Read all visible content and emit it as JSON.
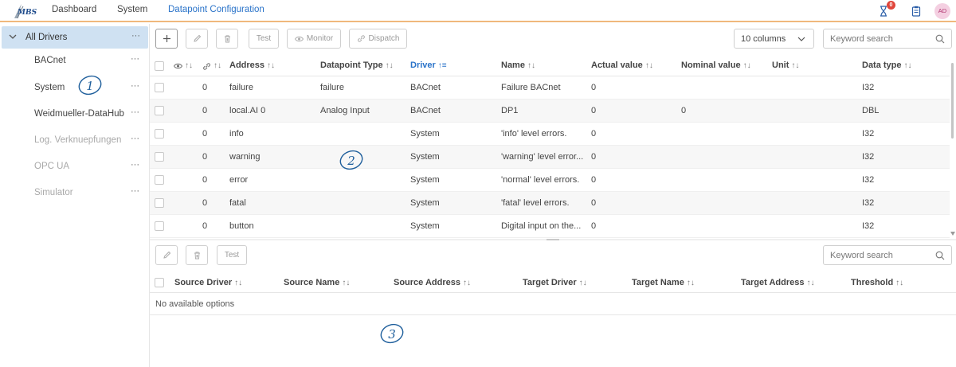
{
  "app": {
    "logo_text": "MBS"
  },
  "nav": {
    "items": [
      {
        "label": "Dashboard",
        "active": false
      },
      {
        "label": "System",
        "active": false
      },
      {
        "label": "Datapoint Configuration",
        "active": true
      }
    ]
  },
  "top_icons": {
    "notification_count": "0",
    "avatar_initials": "AD"
  },
  "sidebar": {
    "root": {
      "label": "All Drivers",
      "more": "···"
    },
    "items": [
      {
        "label": "BACnet",
        "enabled": true,
        "more": "···"
      },
      {
        "label": "System",
        "enabled": true,
        "more": "···"
      },
      {
        "label": "Weidmueller-DataHub",
        "enabled": true,
        "more": "···"
      },
      {
        "label": "Log. Verknuepfungen",
        "enabled": false,
        "more": "···"
      },
      {
        "label": "OPC UA",
        "enabled": false,
        "more": "···"
      },
      {
        "label": "Simulator",
        "enabled": false,
        "more": "···"
      }
    ]
  },
  "toolbar": {
    "test_label": "Test",
    "monitor_label": "Monitor",
    "dispatch_label": "Dispatch",
    "columns_select": "10 columns",
    "search_placeholder": "Keyword search"
  },
  "table": {
    "columns": {
      "address": "Address",
      "datapoint_type": "Datapoint Type",
      "driver": "Driver",
      "name": "Name",
      "actual_value": "Actual value",
      "nominal_value": "Nominal value",
      "unit": "Unit",
      "data_type": "Data type"
    },
    "sort_icon": "↑↓",
    "sorted_icon": "↑≡",
    "rows": [
      {
        "v1": "0",
        "address": "failure",
        "datapoint_type": "failure",
        "driver": "BACnet",
        "name": "Failure BACnet",
        "actual": "0",
        "nominal": "",
        "unit": "",
        "data_type": "I32"
      },
      {
        "v1": "0",
        "address": "local.AI 0",
        "datapoint_type": "Analog Input",
        "driver": "BACnet",
        "name": "DP1",
        "actual": "0",
        "nominal": "0",
        "unit": "",
        "data_type": "DBL"
      },
      {
        "v1": "0",
        "address": "info",
        "datapoint_type": "",
        "driver": "System",
        "name": "'info' level errors.",
        "actual": "0",
        "nominal": "",
        "unit": "",
        "data_type": "I32"
      },
      {
        "v1": "0",
        "address": "warning",
        "datapoint_type": "",
        "driver": "System",
        "name": "'warning' level error...",
        "actual": "0",
        "nominal": "",
        "unit": "",
        "data_type": "I32"
      },
      {
        "v1": "0",
        "address": "error",
        "datapoint_type": "",
        "driver": "System",
        "name": "'normal' level errors.",
        "actual": "0",
        "nominal": "",
        "unit": "",
        "data_type": "I32"
      },
      {
        "v1": "0",
        "address": "fatal",
        "datapoint_type": "",
        "driver": "System",
        "name": "'fatal' level errors.",
        "actual": "0",
        "nominal": "",
        "unit": "",
        "data_type": "I32"
      },
      {
        "v1": "0",
        "address": "button",
        "datapoint_type": "",
        "driver": "System",
        "name": "Digital input on the...",
        "actual": "0",
        "nominal": "",
        "unit": "",
        "data_type": "I32"
      }
    ]
  },
  "bottom": {
    "test_label": "Test",
    "search_placeholder": "Keyword search",
    "columns": {
      "source_driver": "Source Driver",
      "source_name": "Source Name",
      "source_address": "Source Address",
      "target_driver": "Target Driver",
      "target_name": "Target Name",
      "target_address": "Target Address",
      "threshold": "Threshold"
    },
    "empty_text": "No available options"
  },
  "annotations": [
    "1",
    "2",
    "3"
  ],
  "colors": {
    "accent": "#2a73c9",
    "nav_underline": "#f0b87c",
    "selected_bg": "#cfe1f2",
    "badge": "#e0463b",
    "annotation": "#1f5f9c"
  }
}
